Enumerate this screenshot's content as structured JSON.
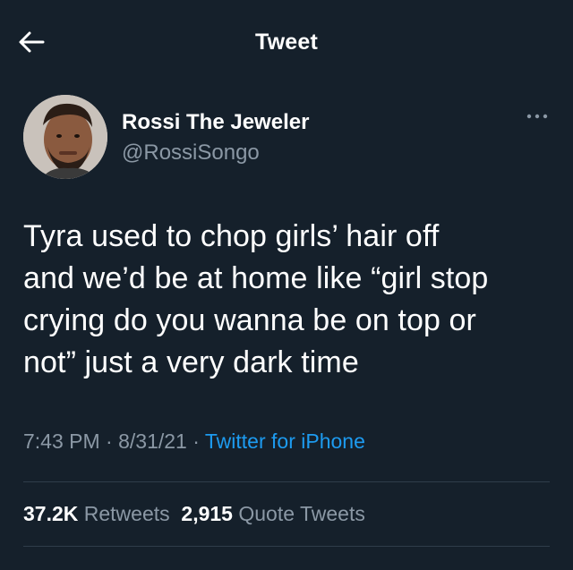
{
  "header": {
    "title": "Tweet",
    "back_icon": "arrow-left-icon"
  },
  "author": {
    "display_name": "Rossi The Jeweler",
    "handle": "@RossiSongo",
    "avatar_icon": "profile-photo"
  },
  "more_icon": "more-horizontal-icon",
  "tweet": {
    "lines": [
      "Tyra used to chop girls’ hair off",
      "and we’d be at home like “girl stop",
      "crying do you wanna be on top or",
      "not” just a very dark time"
    ]
  },
  "meta": {
    "time": "7:43 PM",
    "sep1": " · ",
    "date": "8/31/21",
    "sep2": " · ",
    "source": "Twitter for iPhone"
  },
  "stats": {
    "retweets_count": "37.2K",
    "retweets_label": "Retweets",
    "quotes_count": "2,915",
    "quotes_label": "Quote Tweets"
  },
  "colors": {
    "background": "#15202b",
    "text": "#ffffff",
    "secondary": "#8b98a5",
    "link": "#1d9bf0",
    "divider": "#2f3d4a"
  }
}
